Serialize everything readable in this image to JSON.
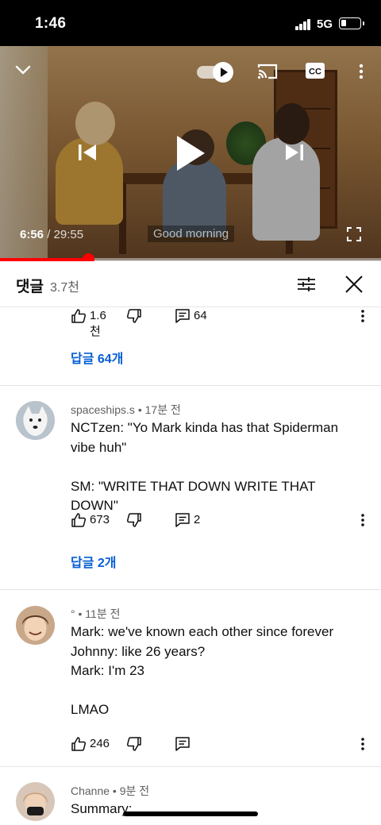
{
  "status_bar": {
    "time": "1:46",
    "network": "5G"
  },
  "player": {
    "current_time": "6:56",
    "separator": " / ",
    "duration": "29:55",
    "caption": "Good morning",
    "progress": 0.232
  },
  "comments_header": {
    "title": "댓글",
    "count": "3.7천"
  },
  "previous_comment": {
    "likes": "1.6천",
    "replies": "64",
    "reply_link": "답글 64개"
  },
  "comments": [
    {
      "author": "spaceships.s",
      "time": "17분 전",
      "text": "NCTzen: \"Yo Mark kinda has that Spiderman vibe huh\"\n\nSM: \"WRITE THAT DOWN WRITE THAT DOWN\"",
      "likes": "673",
      "replies": "2",
      "reply_link": "답글 2개"
    },
    {
      "author": "°",
      "time": "11분 전",
      "text": "Mark: we've known each other since forever\nJohnny: like 26 years?\nMark: I'm 23\n\nLMAO",
      "likes": "246"
    },
    {
      "author": "Channe",
      "time": "9분 전",
      "text": "Summary:"
    }
  ],
  "meta_separator": " • ",
  "colors": {
    "progress": "#ff0000",
    "link": "#065fd4",
    "status_bar": "#000000"
  }
}
